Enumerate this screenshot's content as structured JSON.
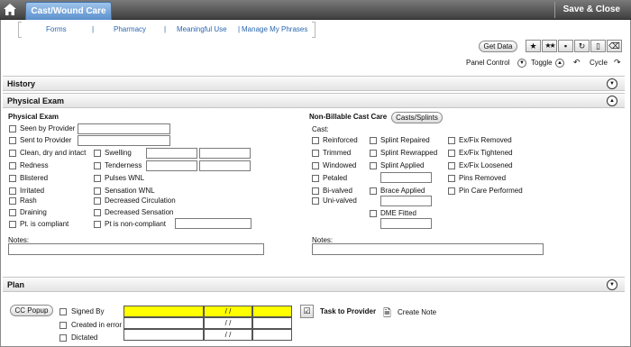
{
  "header": {
    "active_tab": "Cast/Wound Care",
    "save_close": "Save & Close"
  },
  "nav": {
    "forms": "Forms",
    "pharmacy": "Pharmacy",
    "meaningful_use": "Meaningful Use",
    "manage_phrases": "Manage My Phrases",
    "sep": "|"
  },
  "toolbar": {
    "get_data": "Get Data",
    "panel_control": "Panel Control",
    "toggle": "Toggle",
    "cycle": "Cycle"
  },
  "sections": {
    "history": "History",
    "physical_exam": "Physical Exam",
    "plan": "Plan"
  },
  "physical_exam": {
    "title": "Physical Exam",
    "seen_by_provider": "Seen by Provider",
    "sent_to_provider": "Sent to Provider",
    "clean_dry_intact": "Clean, dry and intact",
    "swelling": "Swelling",
    "redness": "Redness",
    "tenderness": "Tenderness",
    "blistered": "Blistered",
    "pulses_wnl": "Pulses WNL",
    "irritated": "Irritated",
    "sensation_wnl": "Sensation WNL",
    "rash": "Rash",
    "decreased_circulation": "Decreased Circulation",
    "draining": "Draining",
    "decreased_sensation": "Decreased Sensation",
    "pt_compliant": "Pt. is compliant",
    "pt_noncompliant": "Pt is non-compliant",
    "notes": "Notes:"
  },
  "cast_care": {
    "title": "Non-Billable Cast Care",
    "casts_button": "Casts/Splints",
    "cast_label": "Cast:",
    "reinforced": "Reinforced",
    "trimmed": "Trimmed",
    "windowed": "Windowed",
    "petaled": "Petaled",
    "bivalved": "Bi-valved",
    "univalved": "Uni-valved",
    "splint_repaired": "Splint Repaired",
    "splint_rewrapped": "Splint Rewrapped",
    "splint_applied": "Splint Applied",
    "brace_applied": "Brace Applied",
    "dme_fitted": "DME Fitted",
    "exfix_removed": "Ex/Fix Removed",
    "exfix_tightened": "Ex/Fix Tightened",
    "exfix_loosened": "Ex/Fix Loosened",
    "pins_removed": "Pins Removed",
    "pin_care": "Pin Care Performed",
    "notes": "Notes:"
  },
  "plan": {
    "cc_popup": "CC Popup",
    "signed_by": "Signed By",
    "created_in_error": "Created in error",
    "dictated": "Dictated",
    "date_placeholder": "/ /",
    "task_to_provider": "Task to Provider",
    "create_note": "Create Note"
  },
  "colors": {
    "active_tab": "#5b8fcd",
    "link": "#2a66b0",
    "highlight": "#ffff00"
  }
}
